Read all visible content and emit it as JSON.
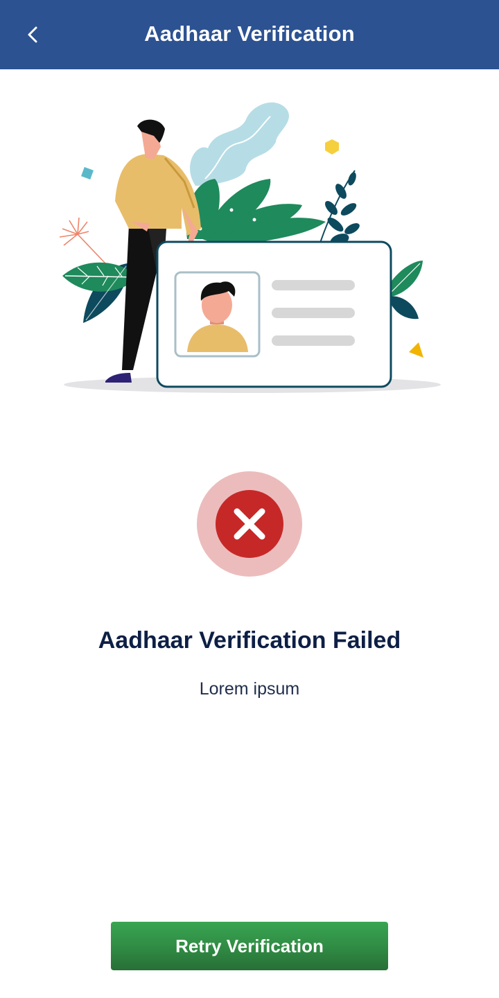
{
  "header": {
    "title": "Aadhaar Verification",
    "back_icon": "chevron-left-icon",
    "background_color": "#2c5292"
  },
  "illustration": {
    "subject": "person-with-id-card-illustration"
  },
  "status": {
    "icon": "error-x-icon",
    "icon_color": "#c62828",
    "halo_color": "#ecbcbd",
    "title": "Aadhaar Verification Failed",
    "message": "Lorem ipsum"
  },
  "actions": {
    "retry_label": "Retry Verification",
    "retry_color": "#33994b"
  }
}
